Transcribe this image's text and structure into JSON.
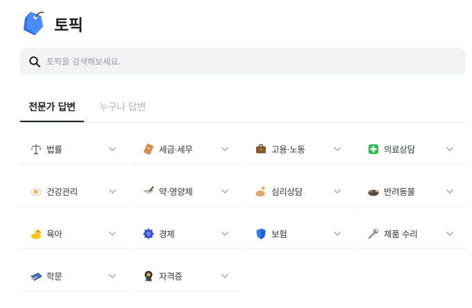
{
  "header": {
    "title": "토픽",
    "icon": "price-tag-icon"
  },
  "search": {
    "placeholder": "토픽을 검색해보세요.",
    "value": "",
    "icon": "search-icon"
  },
  "tabs": [
    {
      "label": "전문가 답변",
      "active": true
    },
    {
      "label": "누구나 답변",
      "active": false
    }
  ],
  "categories": [
    {
      "label": "법률",
      "icon": "balance-scale-icon"
    },
    {
      "label": "세금·세무",
      "icon": "receipt-icon"
    },
    {
      "label": "고용·노동",
      "icon": "briefcase-icon"
    },
    {
      "label": "의료상담",
      "icon": "medical-cross-icon"
    },
    {
      "label": "건강관리",
      "icon": "fried-egg-icon"
    },
    {
      "label": "약·영양제",
      "icon": "mortar-pestle-icon"
    },
    {
      "label": "심리상담",
      "icon": "heart-hand-icon"
    },
    {
      "label": "반려동물",
      "icon": "pet-icon"
    },
    {
      "label": "육아",
      "icon": "rubber-duck-icon"
    },
    {
      "label": "경제",
      "icon": "coin-badge-icon"
    },
    {
      "label": "보험",
      "icon": "shield-icon"
    },
    {
      "label": "제품 수리",
      "icon": "wrench-icon"
    },
    {
      "label": "학문",
      "icon": "graduation-cap-icon"
    },
    {
      "label": "자격증",
      "icon": "medal-icon"
    }
  ],
  "colors": {
    "accent": "#1b1d1f",
    "muted_tab": "#b4b7bc",
    "search_bg": "#f2f3f5",
    "tag_blue": "#3c7ef3"
  }
}
